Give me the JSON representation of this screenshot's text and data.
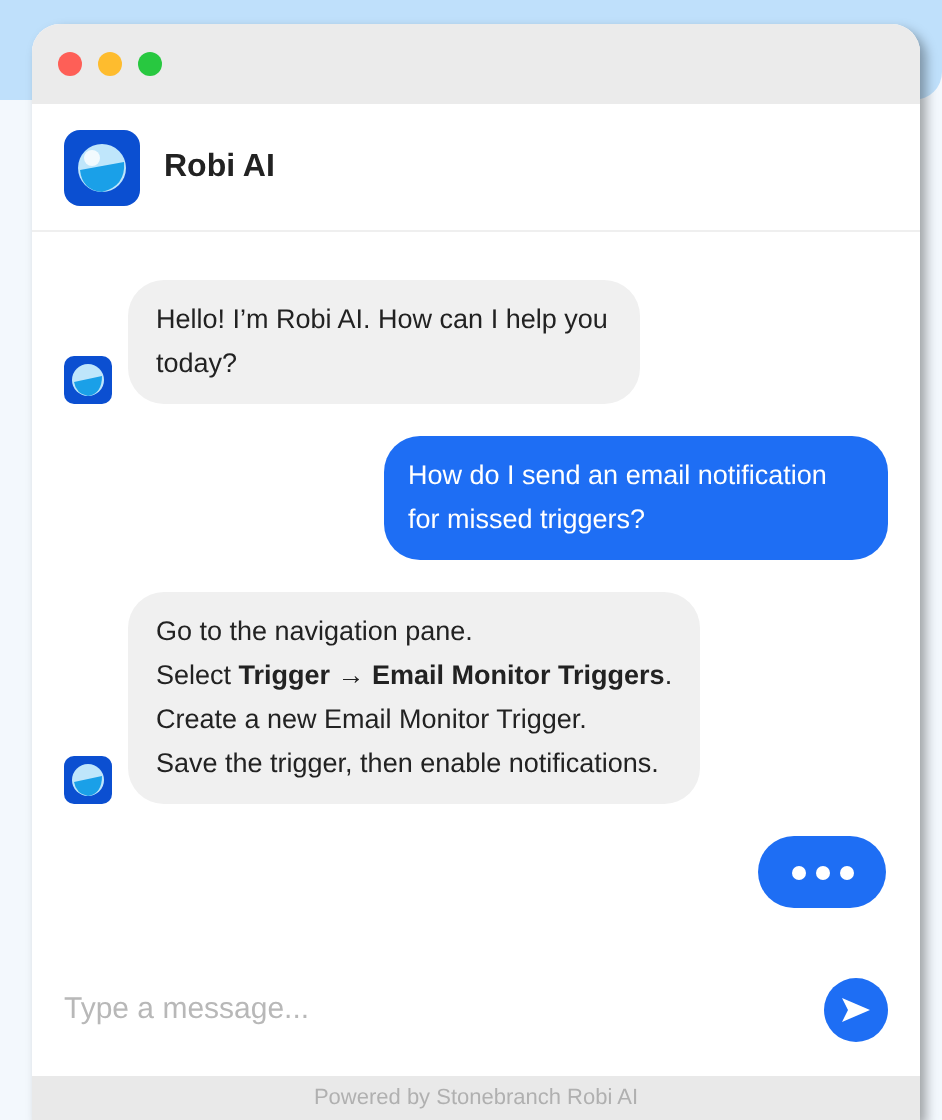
{
  "header": {
    "title": "Robi AI"
  },
  "messages": [
    {
      "kind": "bot",
      "lines": [
        "Hello! I’m Robi AI. How can I help you today?"
      ]
    },
    {
      "kind": "user",
      "lines": [
        "How do I send an email notification for missed triggers?"
      ]
    },
    {
      "kind": "bot",
      "lines": [
        "Go to the navigation pane.",
        "Select **Trigger → Email Monitor Triggers**.",
        "Create a new Email Monitor Trigger.",
        "Save the trigger, then enable notifications."
      ]
    },
    {
      "kind": "typing"
    }
  ],
  "composer": {
    "placeholder": "Type a message..."
  },
  "footer": "Powered by Stonebranch Robi AI"
}
